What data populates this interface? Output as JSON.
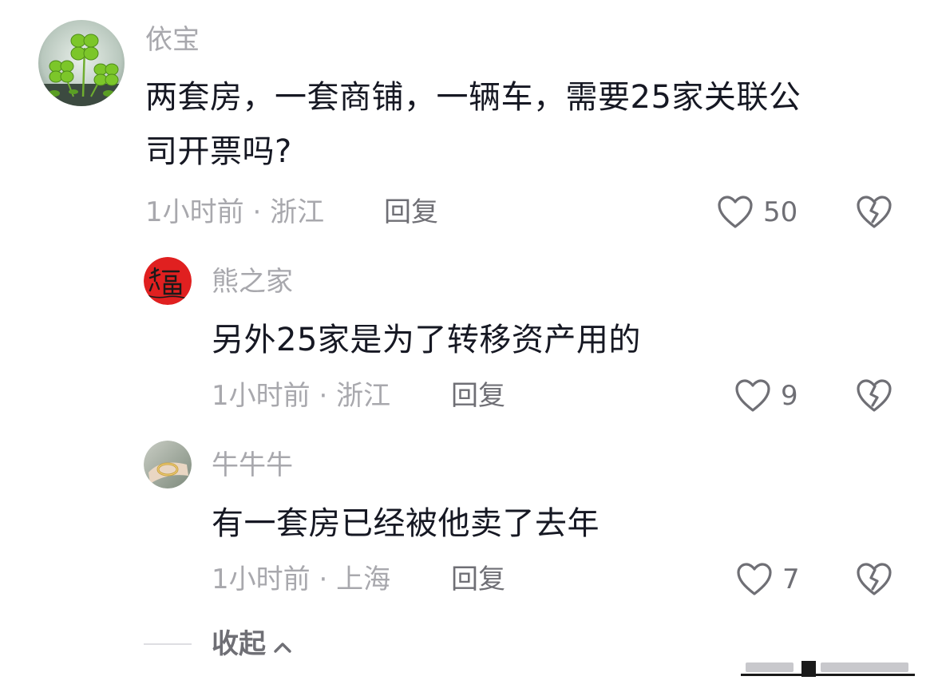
{
  "colors": {
    "muted_text": "#a8a8ad",
    "action_text": "#6f6f75",
    "primary_text": "#161823",
    "icon_stroke": "#6f6f75"
  },
  "comments": [
    {
      "username": "依宝",
      "avatar_icon": "clover-avatar",
      "text_lines": [
        "两套房，一套商铺，一辆车，需要25家关联公",
        "司开票吗?"
      ],
      "time": "1小时前",
      "separator": "·",
      "location": "浙江",
      "reply_label": "回复",
      "likes": "50"
    },
    {
      "username": "熊之家",
      "avatar_icon": "fu-character-avatar",
      "text_lines": [
        "另外25家是为了转移资产用的"
      ],
      "time": "1小时前",
      "separator": "·",
      "location": "浙江",
      "reply_label": "回复",
      "likes": "9"
    },
    {
      "username": "牛牛牛",
      "avatar_icon": "bracelet-avatar",
      "text_lines": [
        "有一套房已经被他卖了去年"
      ],
      "time": "1小时前",
      "separator": "·",
      "location": "上海",
      "reply_label": "回复",
      "likes": "7"
    }
  ],
  "collapse_label": "收起",
  "collapse_icon": "chevron-up-icon"
}
